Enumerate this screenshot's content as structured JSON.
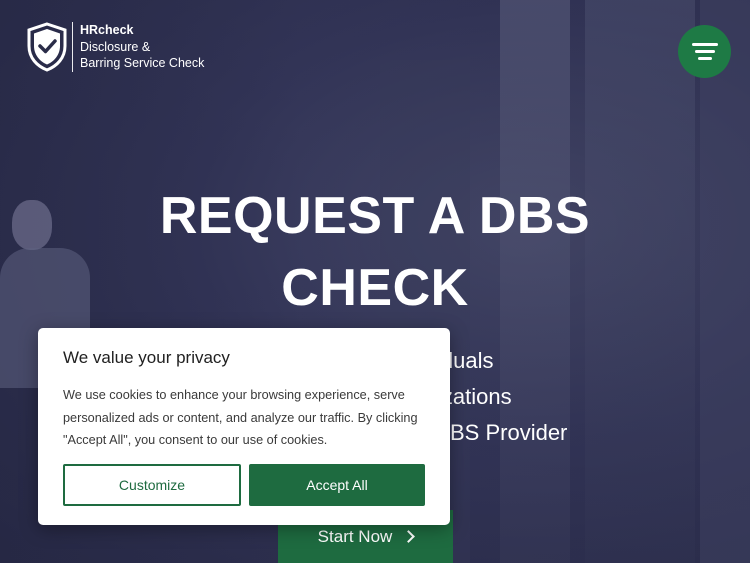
{
  "header": {
    "logo": {
      "brand": "HRcheck",
      "line2": "Disclosure &",
      "line3": "Barring Service Check",
      "icon": "shield-check-icon"
    },
    "menu_icon": "hamburger-menu-icon"
  },
  "hero": {
    "title_line1": "REQUEST A DBS",
    "title_line2": "CHECK",
    "bullets": [
      "viduals",
      "izations",
      "BS Provider"
    ],
    "cta_label": "Start Now",
    "cta_icon": "chevron-right-icon"
  },
  "cookie_banner": {
    "title": "We value your privacy",
    "text": "We use cookies to enhance your browsing experience, serve personalized ads or content, and analyze our traffic. By clicking \"Accept All\", you consent to our use of cookies.",
    "customize_label": "Customize",
    "accept_label": "Accept All"
  },
  "colors": {
    "accent_green": "#1e6b40",
    "menu_green": "#1e7a45",
    "hero_bg": "#2a2c48"
  }
}
